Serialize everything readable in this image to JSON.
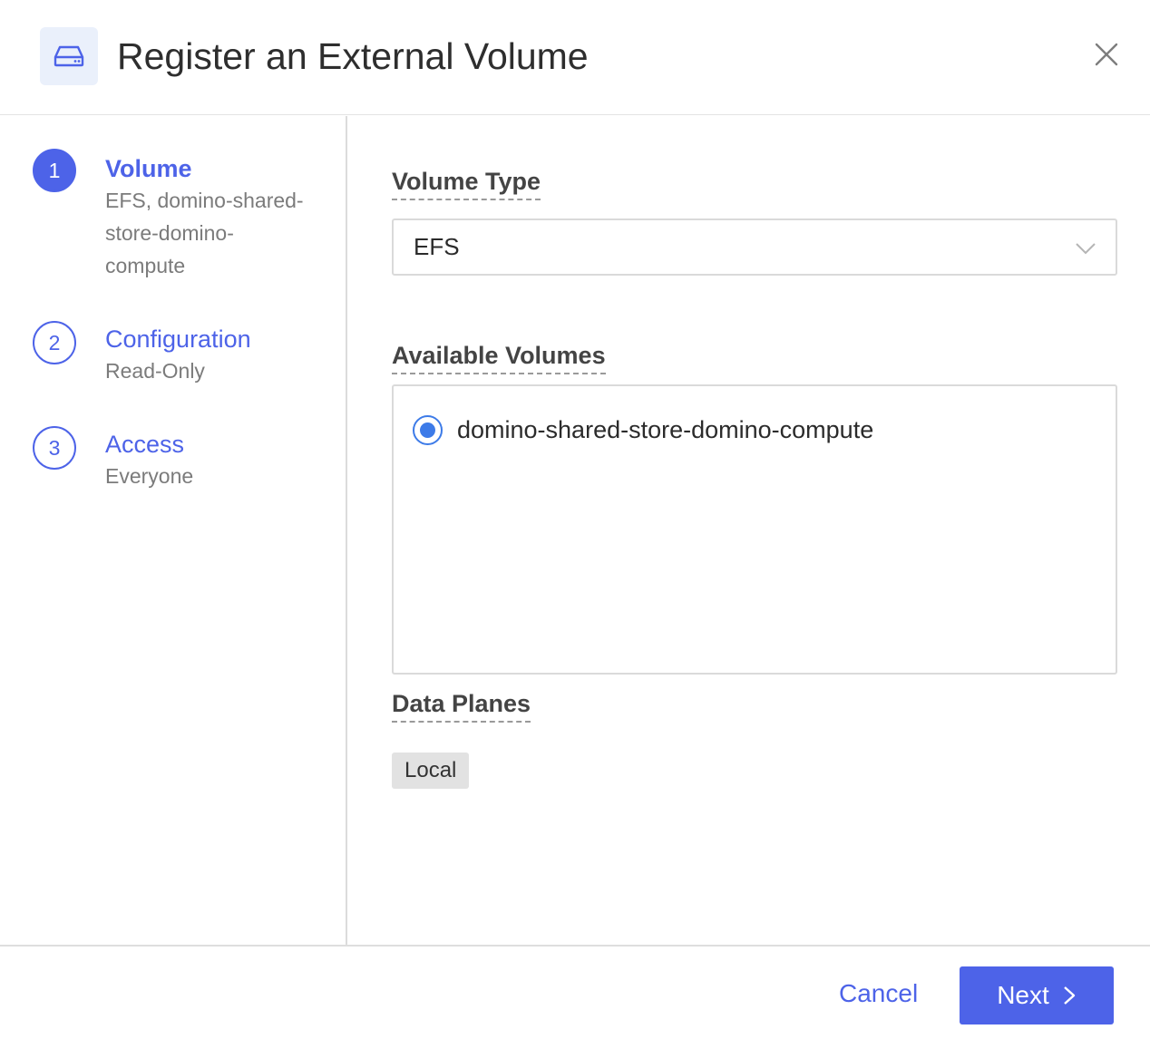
{
  "dialog": {
    "title": "Register an External Volume",
    "icon": "hard-drive-icon",
    "close_icon": "close-icon"
  },
  "steps": [
    {
      "number": "1",
      "title": "Volume",
      "subtitle": "EFS, domino-shared-store-domino-compute",
      "active": true
    },
    {
      "number": "2",
      "title": "Configuration",
      "subtitle": "Read-Only",
      "active": false
    },
    {
      "number": "3",
      "title": "Access",
      "subtitle": "Everyone",
      "active": false
    }
  ],
  "form": {
    "volume_type_label": "Volume Type",
    "volume_type_value": "EFS",
    "available_volumes_label": "Available Volumes",
    "available_volumes": [
      {
        "name": "domino-shared-store-domino-compute",
        "selected": true
      }
    ],
    "data_planes_label": "Data Planes",
    "data_planes": [
      "Local"
    ]
  },
  "footer": {
    "cancel_label": "Cancel",
    "next_label": "Next"
  },
  "colors": {
    "accent": "#4d63e8",
    "radio": "#3d7be8",
    "icon_bg": "#eaf0fb",
    "tag_bg": "#e2e2e2"
  }
}
